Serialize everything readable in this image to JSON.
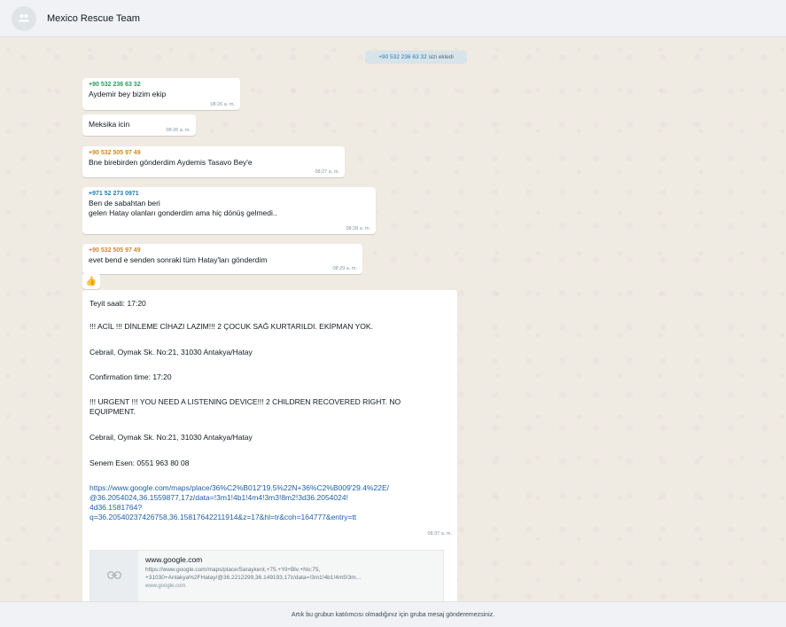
{
  "header": {
    "title": "Mexico Rescue Team",
    "avatar_icon": "group-icon"
  },
  "system_message": {
    "phone": "+90 532 236 63 32",
    "text": "sizi ekledi"
  },
  "messages": [
    {
      "sender": "+90 532 236 63 32",
      "sender_color": "#25a05c",
      "text": "Aydemir bey bizim ekip",
      "time": "08:26 a. m."
    },
    {
      "sender": "",
      "text": "Meksika icin",
      "time": "08:26 a. m."
    },
    {
      "sender": "+90 532 505 97 49",
      "sender_color": "#d18a1f",
      "text": "Bne birebirden gönderdim Aydemis Tasavo Bey'e",
      "time": "08:27 a. m."
    },
    {
      "sender": "+971 52 273 0971",
      "sender_color": "#1d7db5",
      "line1": "Ben de sabahtan beri",
      "line2": "gelen Hatay olanları gonderdim ama hiç dönüş gelmedi..",
      "time": "08:28 a. m."
    },
    {
      "sender": "+90 532 505 97 49",
      "sender_color": "#d18a1f",
      "text": "evet bend e senden sonraki tüm Hatay'ları gönderdim",
      "time": "08:29 a. m."
    }
  ],
  "reaction": {
    "emoji": "👍",
    "icon": "thumbs-up-icon"
  },
  "long_message": {
    "line1": "Teyit saati: 17:20",
    "line2": "!!! ACİL !!! DİNLEME CİHAZI LAZIM!!! 2 ÇOCUK SAĞ KURTARILDI. EKİPMAN YOK.",
    "line3": "Cebrail, Oymak Sk. No:21, 31030 Antakya/Hatay",
    "line4": "Confirmation time: 17:20",
    "line5a": "!!! URGENT !!! YOU NEED A LISTENING DEVICE!!! 2 CHILDREN RECOVERED RIGHT. NO",
    "line5b": "EQUIPMENT.",
    "line6": "Cebrail, Oymak Sk. No:21, 31030 Antakya/Hatay",
    "line7": "Senem Esen: 0551 963 80 08",
    "link1": "https://www.google.com/maps/place/36%C2%B012'19.5%22N+36%C2%B009'29.4%22E/",
    "link2": "@36.2054024,36.1559877,17z/data=!3m1!4b1!4m4!3m3!8m2!3d36.2054024!",
    "link3": "4d36.1581764?",
    "link4": "q=36.20540237426758,36.15817642211914&z=17&hl=tr&coh=164777&entry=tt",
    "time": "08:37 a. m."
  },
  "link_preview": {
    "title": "www.google.com",
    "desc1": "https://www.google.com/maps/place/Saraykent,+75.+Yil+Blv.+No:75,",
    "desc2": "+31030+Antakya%2FHatay/@36.2212299,36.149193,17z/data=!3m1!4b1!4m5!3m...",
    "domain": "www.google.com",
    "icon": "link-icon"
  },
  "footer": {
    "text": "Artık bu grubun katılımcısı olmadığınız için gruba mesaj gönderemezsiniz."
  }
}
